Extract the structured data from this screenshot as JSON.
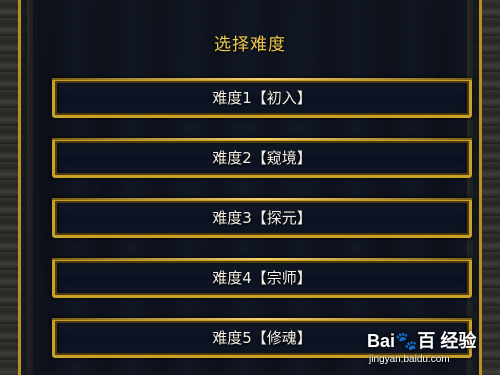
{
  "dialog": {
    "title": "选择难度",
    "options": [
      {
        "label": "难度1【初入】"
      },
      {
        "label": "难度2【窥境】"
      },
      {
        "label": "难度3【探元】"
      },
      {
        "label": "难度4【宗师】"
      },
      {
        "label": "难度5【修魂】"
      }
    ]
  },
  "watermark": {
    "logo_text": "Bai🐾百 经验",
    "url": "jingyan.baidu.com"
  },
  "colors": {
    "gold_border": "#c9a227",
    "title_text": "#f2c94c",
    "button_text": "#f4f0e4",
    "button_bg": "#0b1120"
  }
}
